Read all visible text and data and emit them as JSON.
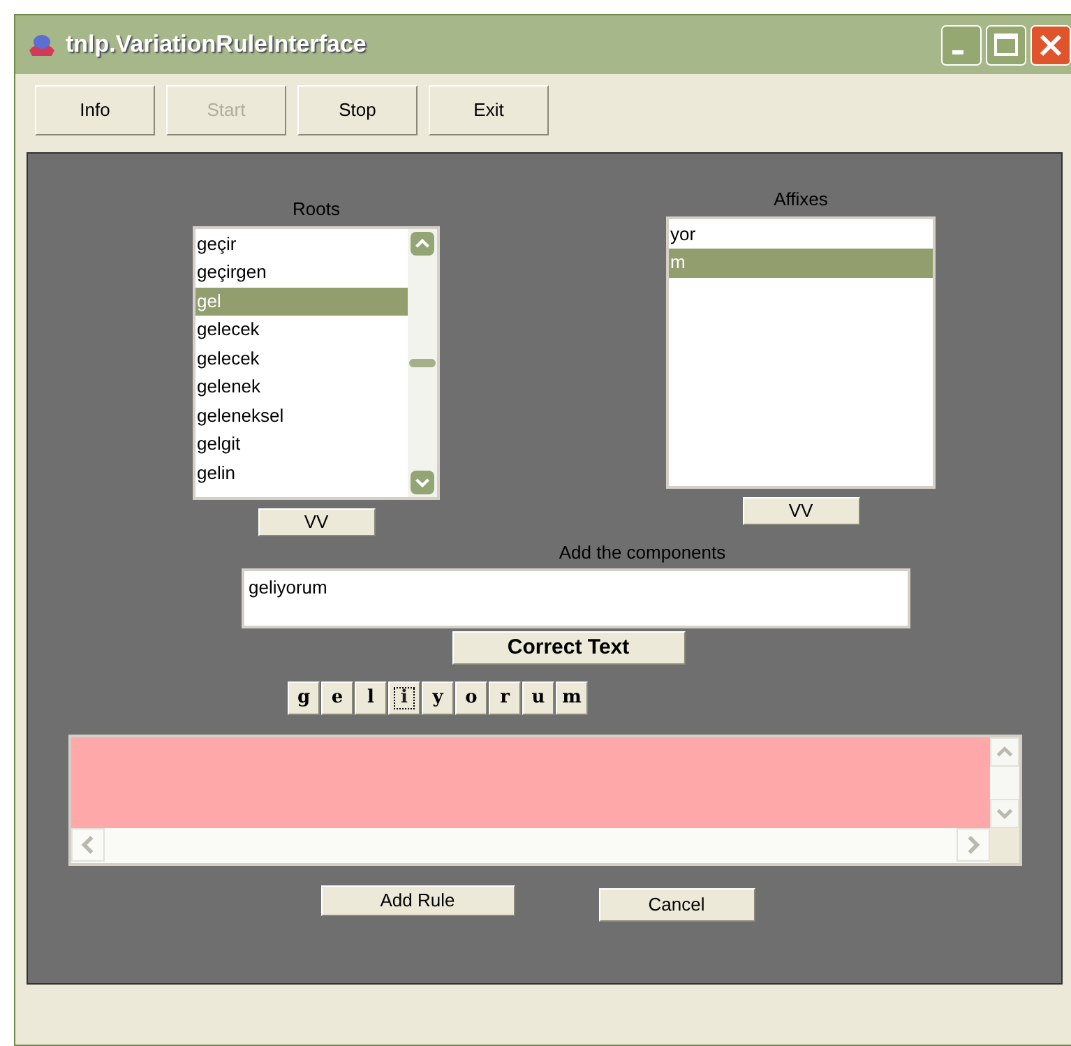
{
  "window": {
    "title": "tnlp.VariationRuleInterface"
  },
  "toolbar": [
    {
      "label": "Info",
      "disabled": false
    },
    {
      "label": "Start",
      "disabled": true
    },
    {
      "label": "Stop",
      "disabled": false
    },
    {
      "label": "Exit",
      "disabled": false
    }
  ],
  "roots": {
    "label": "Roots",
    "items": [
      {
        "text": "geçir",
        "selected": false
      },
      {
        "text": "geçirgen",
        "selected": false
      },
      {
        "text": "gel",
        "selected": true
      },
      {
        "text": "gelecek",
        "selected": false
      },
      {
        "text": "gelecek",
        "selected": false
      },
      {
        "text": "gelenek",
        "selected": false
      },
      {
        "text": "geleneksel",
        "selected": false
      },
      {
        "text": "gelgit",
        "selected": false
      },
      {
        "text": "gelin",
        "selected": false
      }
    ],
    "button": "VV"
  },
  "affixes": {
    "label": "Affixes",
    "items": [
      {
        "text": "yor",
        "selected": false
      },
      {
        "text": "m",
        "selected": true
      }
    ],
    "button": "VV"
  },
  "components": {
    "label": "Add the components",
    "value": "geliyorum",
    "button": "Correct Text"
  },
  "letters": [
    {
      "text": "g",
      "focused": false
    },
    {
      "text": "e",
      "focused": false
    },
    {
      "text": "l",
      "focused": false
    },
    {
      "text": "i",
      "focused": true
    },
    {
      "text": "y",
      "focused": false
    },
    {
      "text": "o",
      "focused": false
    },
    {
      "text": "r",
      "focused": false
    },
    {
      "text": "u",
      "focused": false
    },
    {
      "text": "m",
      "focused": false
    }
  ],
  "actions": [
    "Add Rule",
    "Cancel"
  ]
}
